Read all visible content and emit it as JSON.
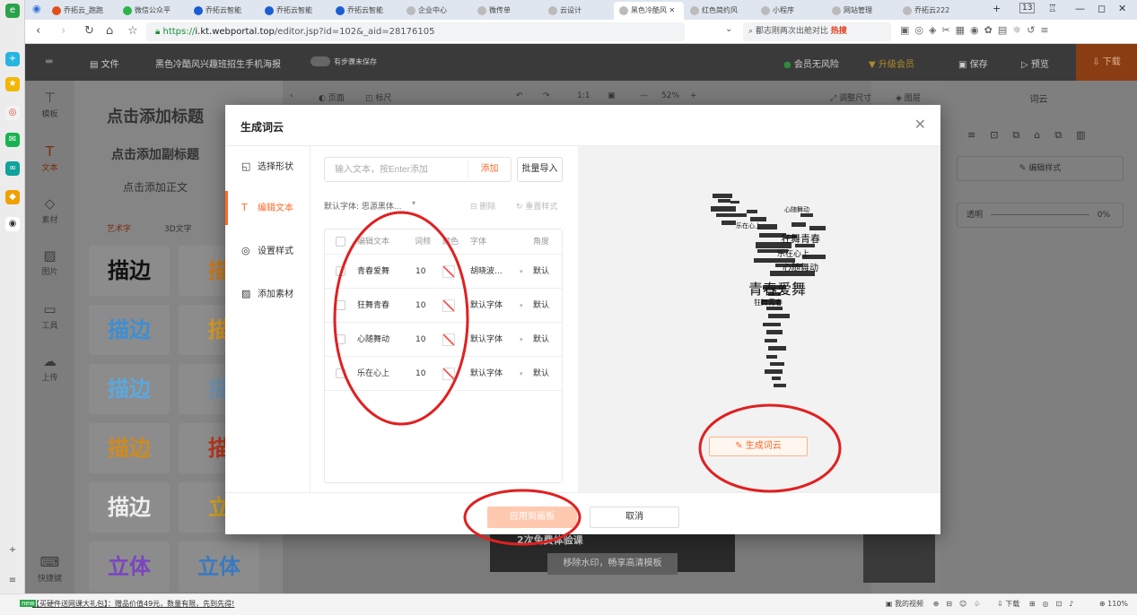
{
  "browser": {
    "tabs": [
      {
        "label": "乔拓云_跑跑",
        "color": "#e0501f"
      },
      {
        "label": "微信公众平",
        "color": "#2db34a"
      },
      {
        "label": "乔拓云智能",
        "color": "#1a5fd1"
      },
      {
        "label": "乔拓云智能",
        "color": "#1a5fd1"
      },
      {
        "label": "乔拓云智能",
        "color": "#1a5fd1"
      },
      {
        "label": "企业中心",
        "color": "#bbbbbb"
      },
      {
        "label": "微传单",
        "color": "#bbbbbb"
      },
      {
        "label": "云设计",
        "color": "#bbbbbb"
      },
      {
        "label": "黑色冷酷风",
        "color": "#bbbbbb",
        "active": true
      },
      {
        "label": "红色简约风",
        "color": "#bbbbbb"
      },
      {
        "label": "小程序",
        "color": "#bbbbbb"
      },
      {
        "label": "网站管理",
        "color": "#bbbbbb"
      },
      {
        "label": "乔拓云222",
        "color": "#bbbbbb"
      }
    ],
    "tab_count": "13",
    "url_scheme": "https://",
    "url_host": "i.kt.webportal.top",
    "url_path": "/editor.jsp?id=102&_aid=28176105",
    "search_text": "鄱志刚两次出舱对比",
    "search_hot": "热搜"
  },
  "editor": {
    "file_label": "文件",
    "doc_title": "黑色冷酷风兴趣班招生手机海报",
    "autosave_label": "有步骤未保存",
    "risk_label": "会员无风险",
    "upgrade_label": "升级会员",
    "save_label": "保存",
    "preview_label": "预览",
    "download_label": "下载",
    "nav": [
      "模板",
      "文本",
      "素材",
      "图片",
      "工具",
      "上传"
    ],
    "shortcut_label": "快捷键",
    "panel_title": "点击添加标题",
    "panel_subtitle": "点击添加副标题",
    "panel_body": "点击添加正文",
    "panel_tabs": [
      "艺术字",
      "3D文字"
    ],
    "tiles": [
      "描边",
      "描",
      "描边",
      "描",
      "描边",
      "描",
      "描边",
      "描",
      "描边",
      "立",
      "立体",
      "立体"
    ],
    "canvas_tools": {
      "page": "页面",
      "ruler": "标尺",
      "zoom": "52%",
      "ratio": "1:1",
      "resize": "调整尺寸",
      "layers": "图层"
    },
    "right_title": "词云",
    "edit_style": "编辑样式",
    "opacity_label": "透明",
    "opacity_value": "0%",
    "poster_text": "2次免费体验课",
    "watermark_text": "移除水印，畅享高清模板"
  },
  "modal": {
    "title": "生成词云",
    "side": [
      {
        "label": "选择形状",
        "icon": "shape-icon"
      },
      {
        "label": "编辑文本",
        "icon": "text-icon",
        "active": true
      },
      {
        "label": "设置样式",
        "icon": "style-icon"
      },
      {
        "label": "添加素材",
        "icon": "image-icon"
      }
    ],
    "input_placeholder": "输入文本，按Enter添加",
    "add_label": "添加",
    "batch_label": "批量导入",
    "default_font": "默认字体: 思源黑体...",
    "delete_label": "删除",
    "reset_label": "重置样式",
    "table": {
      "headers": [
        "编辑文本",
        "词频",
        "颜色",
        "字体",
        "角度"
      ],
      "rows": [
        {
          "text": "青春爱舞",
          "freq": "10",
          "font": "胡晓波...",
          "angle": "默认"
        },
        {
          "text": "狂舞青春",
          "freq": "10",
          "font": "默认字体",
          "angle": "默认"
        },
        {
          "text": "心随舞动",
          "freq": "10",
          "font": "默认字体",
          "angle": "默认"
        },
        {
          "text": "乐在心上",
          "freq": "10",
          "font": "默认字体",
          "angle": "默认"
        }
      ]
    },
    "wordcloud_words": [
      "狂舞青春",
      "乐在心上",
      "心随舞动",
      "青春爱舞",
      "狂舞青春",
      "乐在心上",
      "心随舞动"
    ],
    "generate_label": "生成词云",
    "apply_label": "应用到画板",
    "cancel_label": "取消"
  },
  "statusbar": {
    "promo_badge": "new",
    "promo": "【买硬件送网课大礼包】：赠品价值49元，数量有限，先到先得!",
    "my_video": "我的视频",
    "download": "下载",
    "zoom": "110%"
  }
}
